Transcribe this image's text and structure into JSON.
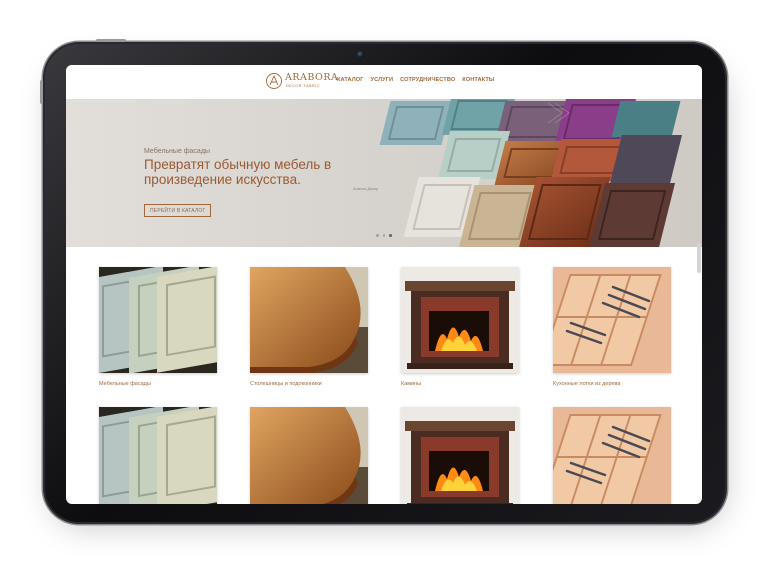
{
  "header": {
    "logo_text": "ARABORA",
    "logo_subtext": "DECOR FABRIC",
    "nav": [
      "КАТАЛОГ",
      "УСЛУГИ",
      "СОТРУДНИЧЕСТВО",
      "КОНТАКТЫ"
    ]
  },
  "hero": {
    "eyebrow": "Мебельные фасады",
    "title": "Превратят обычную мебель в произведение искусства.",
    "button_label": "ПЕРЕЙТИ В КАТАЛОГ",
    "caption": "Arabora Декор",
    "slides_total": 3,
    "active_slide": 3
  },
  "products": [
    {
      "label": "Мебельные фасады",
      "image": "furniture-facades"
    },
    {
      "label": "Столешницы и подоконники",
      "image": "wooden-countertop"
    },
    {
      "label": "Камины",
      "image": "fireplace"
    },
    {
      "label": "Кухонные лотки из дерева",
      "image": "wooden-cutlery-tray"
    },
    {
      "label": "",
      "image": "furniture-facades"
    },
    {
      "label": "",
      "image": "wooden-countertop"
    },
    {
      "label": "",
      "image": "fireplace"
    },
    {
      "label": "",
      "image": "wooden-cutlery-tray"
    }
  ],
  "colors": {
    "accent": "#a0683a",
    "hero_title": "#9a5a34",
    "device_frame": "#1b1b1f"
  }
}
